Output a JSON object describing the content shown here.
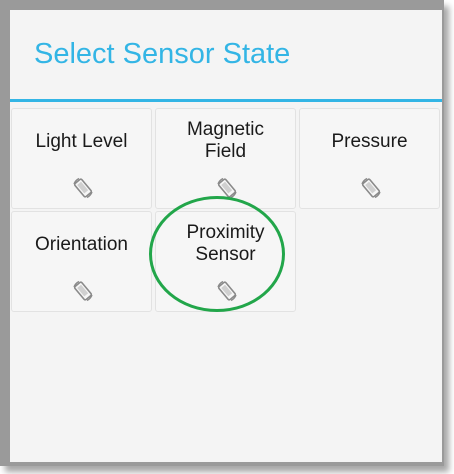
{
  "dialog": {
    "title": "Select Sensor State"
  },
  "sensors": [
    {
      "label_line1": "Light Level",
      "label_line2": "",
      "icon": "screen-rotation-icon"
    },
    {
      "label_line1": "Magnetic",
      "label_line2": "Field",
      "icon": "screen-rotation-icon"
    },
    {
      "label_line1": "Pressure",
      "label_line2": "",
      "icon": "screen-rotation-icon"
    },
    {
      "label_line1": "Orientation",
      "label_line2": "",
      "icon": "screen-rotation-icon"
    },
    {
      "label_line1": "Proximity",
      "label_line2": "Sensor",
      "icon": "screen-rotation-icon"
    }
  ],
  "annotation": {
    "highlighted_item": "Proximity Sensor",
    "color": "#22a64a"
  },
  "colors": {
    "accent": "#33b5e5",
    "text": "#1a1a1a",
    "icon": "#8a8a8a"
  }
}
